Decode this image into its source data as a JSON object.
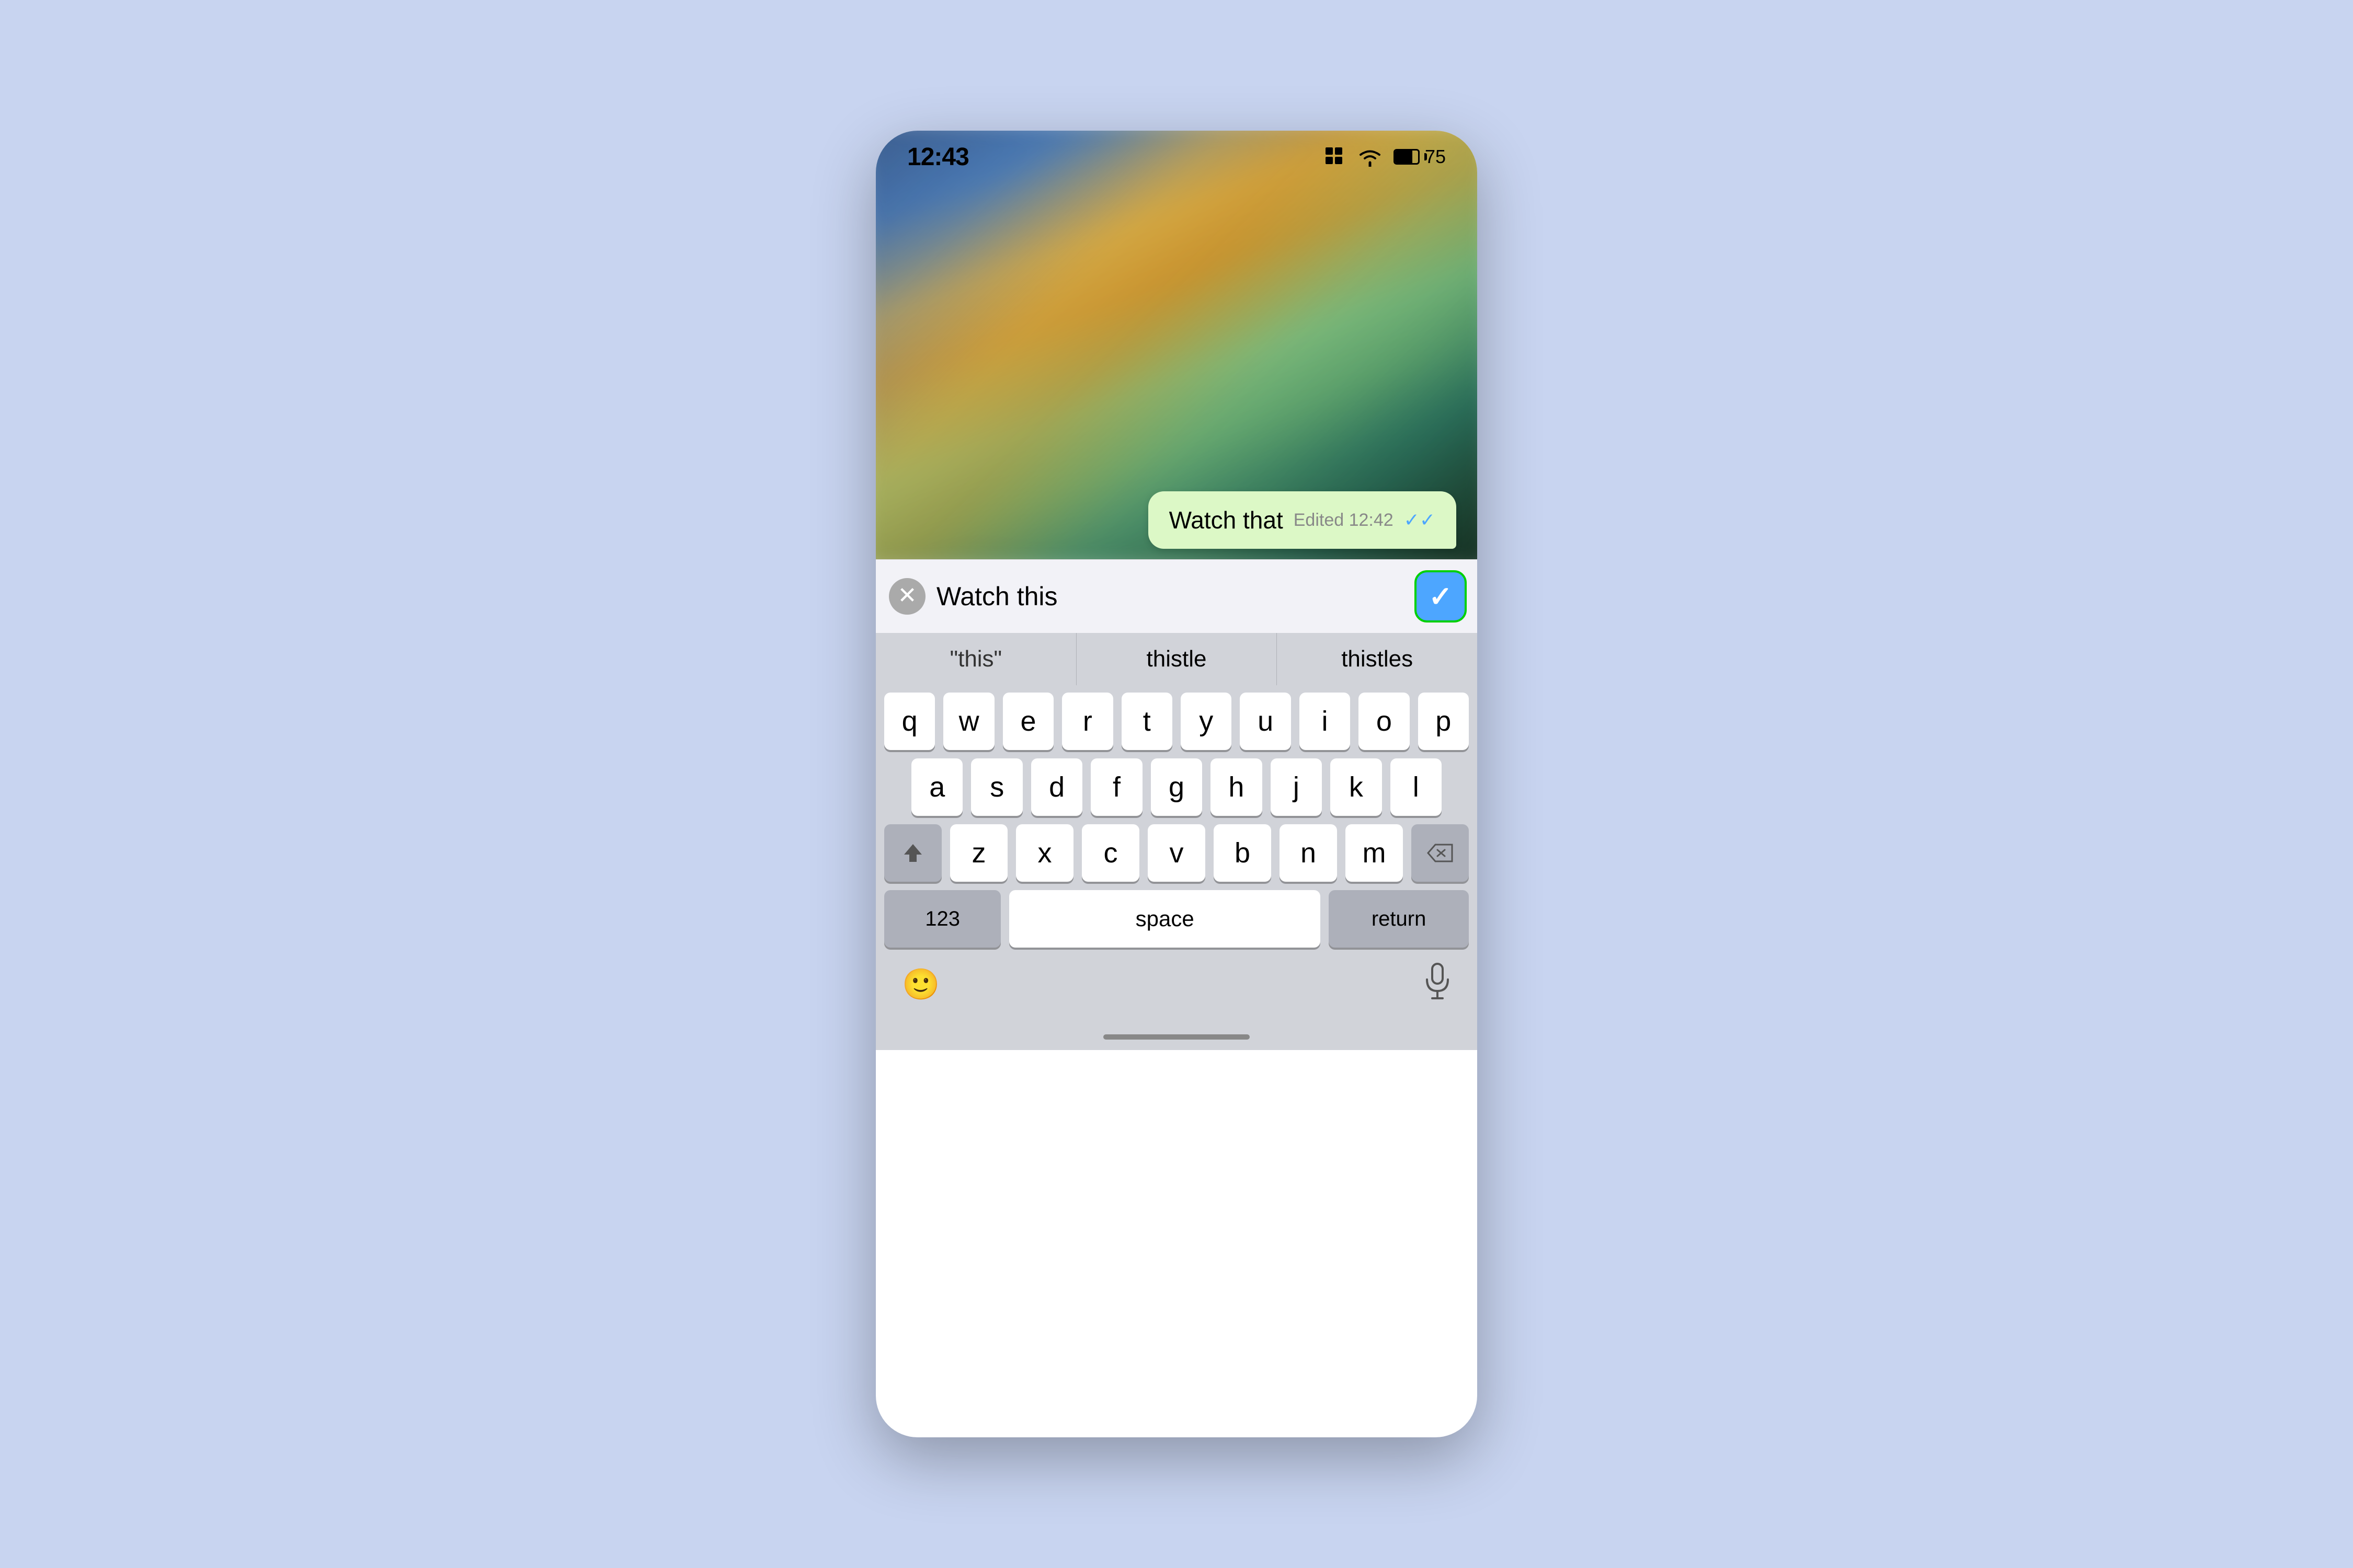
{
  "status_bar": {
    "time": "12:43",
    "battery_level": "75",
    "wifi_icon": "wifi",
    "grid_icon": "grid"
  },
  "message_bubble": {
    "text": "Watch that",
    "edited_label": "Edited 12:42",
    "check_icon": "✓✓"
  },
  "edit_bar": {
    "input_value": "Watch this",
    "clear_label": "×"
  },
  "predictive": {
    "items": [
      {
        "label": "\"this\""
      },
      {
        "label": "thistle"
      },
      {
        "label": "thistles"
      }
    ]
  },
  "keyboard": {
    "rows": [
      [
        "q",
        "w",
        "e",
        "r",
        "t",
        "y",
        "u",
        "i",
        "o",
        "p"
      ],
      [
        "a",
        "s",
        "d",
        "f",
        "g",
        "h",
        "j",
        "k",
        "l"
      ],
      [
        "z",
        "x",
        "c",
        "v",
        "b",
        "n",
        "m"
      ]
    ],
    "space_label": "space",
    "return_label": "return",
    "numbers_label": "123"
  },
  "bottom_bar": {
    "emoji_icon": "emoji",
    "mic_icon": "mic"
  },
  "highlight_color": "#00d000"
}
